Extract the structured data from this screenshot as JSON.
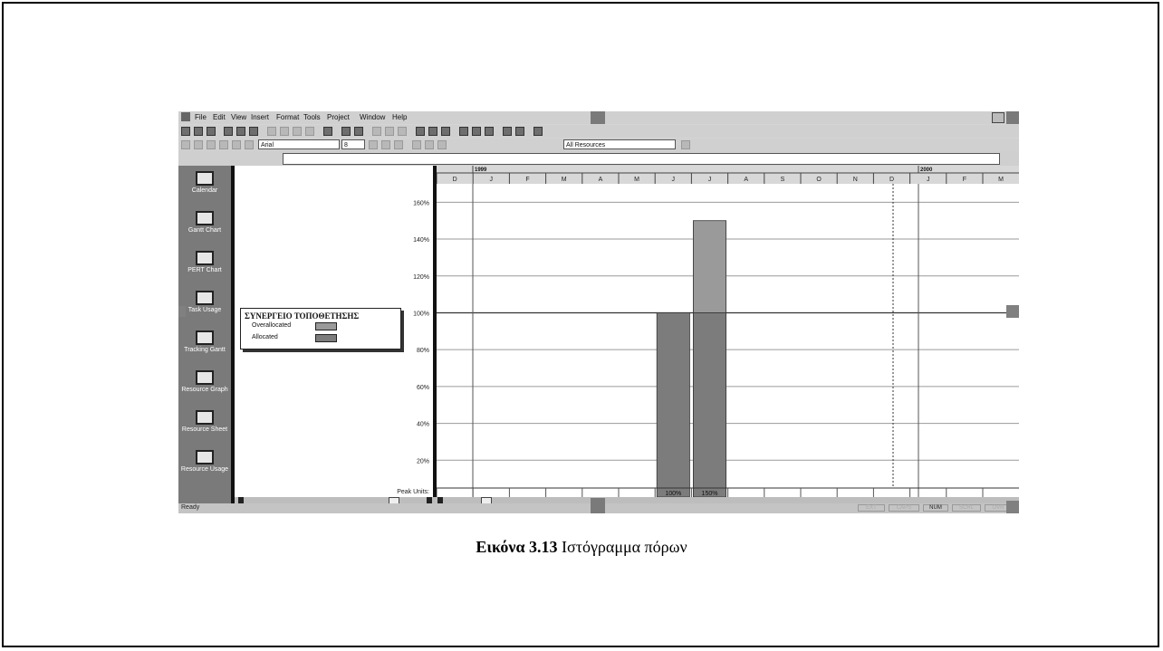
{
  "menu": [
    "File",
    "Edit",
    "View",
    "Insert",
    "Format",
    "Tools",
    "Project",
    "Window",
    "Help"
  ],
  "toolbar": {
    "font_name": "Arial",
    "font_size": "8",
    "filter": "All Resources"
  },
  "view_bar": [
    {
      "icon": "calendar-icon",
      "label": "Calendar"
    },
    {
      "icon": "gantt-chart-icon",
      "label": "Gantt Chart"
    },
    {
      "icon": "pert-chart-icon",
      "label": "PERT Chart"
    },
    {
      "icon": "task-usage-icon",
      "label": "Task Usage"
    },
    {
      "icon": "tracking-gantt-icon",
      "label": "Tracking Gantt"
    },
    {
      "icon": "resource-graph-icon",
      "label": "Resource Graph"
    },
    {
      "icon": "resource-sheet-icon",
      "label": "Resource Sheet"
    },
    {
      "icon": "resource-usage-icon",
      "label": "Resource Usage"
    }
  ],
  "legend": {
    "title": "ΣΥΝΕΡΓΕΙΟ ΤΟΠΟΘΕΤΗΣΗΣ",
    "items": [
      {
        "label": "Overallocated",
        "color": "#9a9a9a"
      },
      {
        "label": "Allocated",
        "color": "#7c7c7c"
      }
    ]
  },
  "peak_units_label": "Peak Units:",
  "timescale": {
    "years": [
      "1999",
      "2000"
    ],
    "months": [
      "D",
      "J",
      "F",
      "M",
      "A",
      "M",
      "J",
      "J",
      "A",
      "S",
      "O",
      "N",
      "D",
      "J",
      "F",
      "M"
    ]
  },
  "status": {
    "ready": "Ready",
    "cells": [
      "EXT",
      "CAPS",
      "NUM",
      "SCRL",
      "OVR"
    ]
  },
  "caption": {
    "bold": "Εικόνα 3.13",
    "text": " Ιστόγραμμα πόρων"
  },
  "chart_data": {
    "type": "bar",
    "title": "",
    "ylabel": "",
    "xlabel": "",
    "ylim": [
      0,
      170
    ],
    "yticks": [
      "20%",
      "40%",
      "60%",
      "80%",
      "100%",
      "120%",
      "140%",
      "160%"
    ],
    "max_units": 100,
    "categories": [
      "D",
      "J",
      "F",
      "M",
      "A",
      "M",
      "J",
      "J",
      "A",
      "S",
      "O",
      "N",
      "D",
      "J",
      "F",
      "M"
    ],
    "values": [
      0,
      0,
      0,
      0,
      0,
      0,
      100,
      150,
      0,
      0,
      0,
      0,
      0,
      0,
      0,
      0
    ],
    "peak_labels": [
      "",
      "",
      "",
      "",
      "",
      "",
      "100%",
      "150%",
      "",
      "",
      "",
      "",
      "",
      "",
      "",
      ""
    ],
    "grid": true
  }
}
